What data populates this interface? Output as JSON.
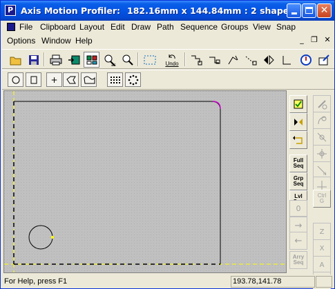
{
  "window": {
    "title": "Axis Motion Profiler:",
    "title_info": "182.16mm x 144.84mm : 2 shape...",
    "app_icon_letter": "P"
  },
  "menu": {
    "row1": [
      "File",
      "Clipboard",
      "Layout",
      "Edit",
      "Draw",
      "Path",
      "Sequence",
      "Groups",
      "View",
      "Snap"
    ],
    "row2": [
      "Options",
      "Window",
      "Help"
    ]
  },
  "toolbar1": {
    "undo_label": "Undo",
    "zoom_label": "×"
  },
  "toolbar2": {
    "items": [
      "circle-tool",
      "rectangle-tool",
      "point-tool",
      "polygon-tool",
      "freehand-tool",
      "grid-array-tool",
      "circular-array-tool"
    ]
  },
  "side_right": {
    "buttons": [
      {
        "label": "Full\nSeq"
      },
      {
        "label": "Grp\nSeq"
      },
      {
        "label": "Lvl\nSeq"
      },
      {
        "label": "0"
      },
      {
        "label": "→"
      },
      {
        "label": "←"
      },
      {
        "label": "Arry\nSeq"
      }
    ]
  },
  "side_far": {
    "buttons": [
      {
        "label": "Ctrl\nG"
      },
      {
        "label": "2"
      },
      {
        "label": "X"
      },
      {
        "label": "A"
      },
      {
        "label": "S"
      }
    ]
  },
  "status": {
    "help": "For Help, press F1",
    "coords": "193.78,141.78"
  },
  "colors": {
    "titlebar": "#0554e3",
    "canvas": "#c0c0c0",
    "axis": "#ffff00",
    "shape": "#000000",
    "corner_highlight": "#cc00cc"
  }
}
